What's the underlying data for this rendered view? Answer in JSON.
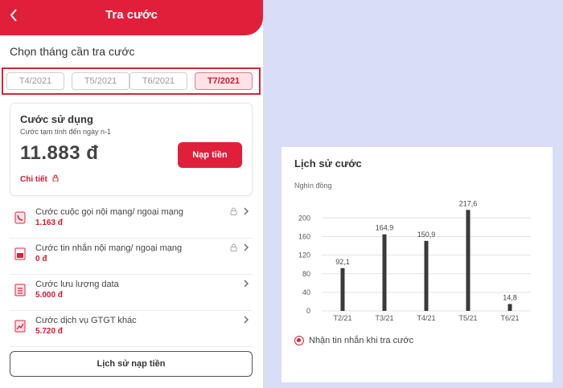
{
  "header": {
    "title": "Tra cước"
  },
  "month_picker": {
    "title": "Chọn tháng cần tra cước",
    "months": [
      "T4/2021",
      "T5/2021",
      "T6/2021",
      "T7/2021"
    ],
    "selected": "T7/2021"
  },
  "usage": {
    "title": "Cước sử dụng",
    "subtitle": "Cước tạm tính đến ngày n-1",
    "amount": "11.883 đ",
    "topup_label": "Nạp tiền",
    "detail_label": "Chi tiết"
  },
  "fees": [
    {
      "label": "Cước cuộc gọi nội mạng/ ngoại mạng",
      "value": "1.163 đ",
      "icon": "phone-icon",
      "locked": true
    },
    {
      "label": "Cước tin nhắn nội mạng/ ngoại mạng",
      "value": "0 đ",
      "icon": "sms-icon",
      "locked": true
    },
    {
      "label": "Cước lưu lượng data",
      "value": "5.000 đ",
      "icon": "data-icon",
      "locked": false
    },
    {
      "label": "Cước dịch vụ GTGT khác",
      "value": "5.720 đ",
      "icon": "vas-icon",
      "locked": false
    }
  ],
  "history_button": "Lịch sử nạp tiền",
  "chart_panel": {
    "title": "Lịch sử cước",
    "unit": "Nghìn đồng",
    "notify_label": "Nhận tin nhắn khi tra cước"
  },
  "chart_data": {
    "type": "bar",
    "title": "Lịch sử cước",
    "ylabel": "Nghìn đồng",
    "categories": [
      "T2/21",
      "T3/21",
      "T4/21",
      "T5/21",
      "T6/21"
    ],
    "values": [
      92.1,
      164.9,
      150.9,
      217.6,
      14.8
    ],
    "value_labels": [
      "92,1",
      "164,9",
      "150,9",
      "217,6",
      "14,8"
    ],
    "yticks": [
      0,
      40,
      80,
      120,
      160,
      200
    ],
    "ylim": [
      0,
      225
    ],
    "grid": true,
    "bar_color": "#3a3a3a"
  },
  "colors": {
    "brand": "#e0203a",
    "background": "#d9ddf5"
  }
}
